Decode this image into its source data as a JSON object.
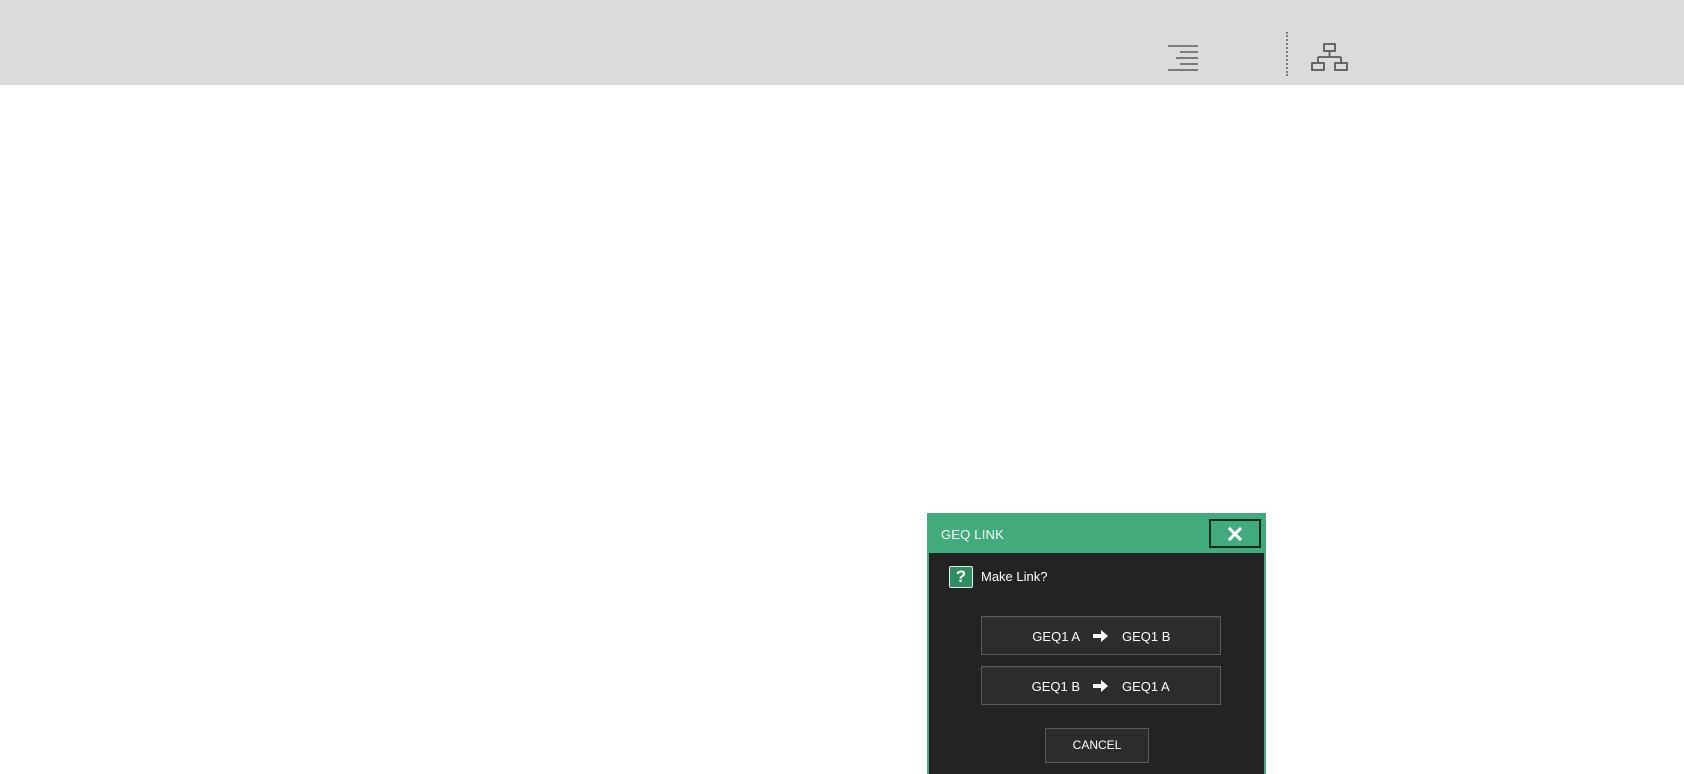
{
  "topbar": {
    "icons": [
      "menu-lines-icon",
      "network-tree-icon"
    ]
  },
  "dialog": {
    "title": "GEQ LINK",
    "prompt": "Make Link?",
    "question_icon_glyph": "?",
    "options": [
      {
        "source": "GEQ1 A",
        "target": "GEQ1 B"
      },
      {
        "source": "GEQ1 B",
        "target": "GEQ1 A"
      }
    ],
    "cancel_label": "CANCEL"
  },
  "colors": {
    "topbar_bg": "#dadbdd",
    "dialog_accent": "#42ab7c",
    "dialog_bg": "#232323",
    "button_bg": "#2c2c2c"
  }
}
